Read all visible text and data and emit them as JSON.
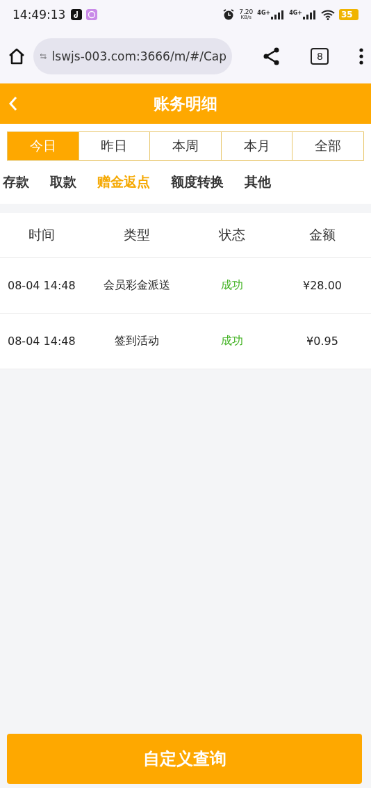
{
  "status_bar": {
    "time": "14:49:13",
    "speed_value": "7.20",
    "speed_unit": "KB/s",
    "networks": [
      "4G+",
      "4G+"
    ],
    "battery": "35"
  },
  "browser": {
    "url": "lswjs-003.com:3666/m/#/Cap",
    "tab_count": "8"
  },
  "header": {
    "title": "账务明细"
  },
  "date_tabs": [
    {
      "label": "今日",
      "selected": true
    },
    {
      "label": "昨日",
      "selected": false
    },
    {
      "label": "本周",
      "selected": false
    },
    {
      "label": "本月",
      "selected": false
    },
    {
      "label": "全部",
      "selected": false
    }
  ],
  "category_tabs": [
    {
      "label": "存款",
      "selected": false
    },
    {
      "label": "取款",
      "selected": false
    },
    {
      "label": "赠金返点",
      "selected": true
    },
    {
      "label": "额度转换",
      "selected": false
    },
    {
      "label": "其他",
      "selected": false
    }
  ],
  "table": {
    "columns": [
      "时间",
      "类型",
      "状态",
      "金额"
    ],
    "rows": [
      {
        "time": "08-04 14:48",
        "type": "会员彩金派送",
        "status": {
          "text": "成功",
          "kind": "success"
        },
        "amount": "¥28.00"
      },
      {
        "time": "08-04 14:48",
        "type": "签到活动",
        "status": {
          "text": "成功",
          "kind": "success"
        },
        "amount": "¥0.95"
      }
    ]
  },
  "query_button": "自定义查询"
}
